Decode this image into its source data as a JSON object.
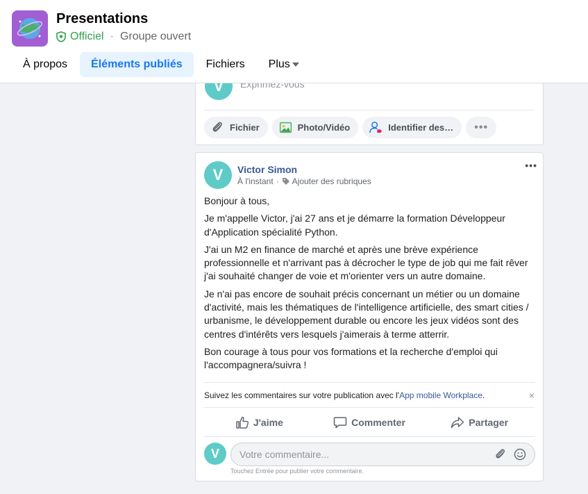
{
  "group": {
    "name": "Presentations",
    "badge": "Officiel",
    "separator": "·",
    "type": "Groupe ouvert",
    "accent": "#a25ed3"
  },
  "tabs": [
    {
      "label": "À propos",
      "active": false
    },
    {
      "label": "Éléments publiés",
      "active": true
    },
    {
      "label": "Fichiers",
      "active": false
    },
    {
      "label": "Plus",
      "active": false
    }
  ],
  "composer": {
    "avatar_letter": "V",
    "placeholder": "Exprimez-vous",
    "actions": [
      {
        "label": "Fichier",
        "icon": "paperclip-icon"
      },
      {
        "label": "Photo/Vidéo",
        "icon": "photo-icon"
      },
      {
        "label": "Identifier des…",
        "icon": "tag-people-icon"
      }
    ],
    "more": "•••"
  },
  "post": {
    "avatar_letter": "V",
    "author": "Victor Simon",
    "time": "À l'instant",
    "dot": "·",
    "topics": "Ajouter des rubriques",
    "menu": "•••",
    "paragraphs": [
      "Bonjour à tous,",
      "Je m'appelle Victor, j'ai 27 ans et je démarre la formation Développeur d'Application spécialité Python.",
      "J'ai un M2 en finance de marché et après une brève expérience professionnelle et n'arrivant pas à décrocher le type de job qui me fait rêver j'ai souhaité changer de voie et m'orienter vers un autre domaine.",
      "Je n'ai pas encore de souhait précis concernant un métier ou un domaine d'activité, mais les thématiques de l'intelligence artificielle, des smart cities / urbanisme, le développement durable ou encore les jeux vidéos sont des centres d'intérêts vers lesquels j'aimerais à terme atterrir.",
      "Bon courage à tous pour vos formations et la recherche d'emploi qui l'accompagnera/suivra !"
    ],
    "notice_text": "Suivez les commentaires sur votre publication avec l'",
    "notice_link": "App mobile Workplace",
    "notice_end": ".",
    "notice_close": "×",
    "actions": {
      "like": "J'aime",
      "comment": "Commenter",
      "share": "Partager"
    },
    "comment_avatar_letter": "V",
    "comment_placeholder": "Votre commentaire...",
    "comment_hint": "Touchez Entrée pour publier votre commentaire."
  }
}
